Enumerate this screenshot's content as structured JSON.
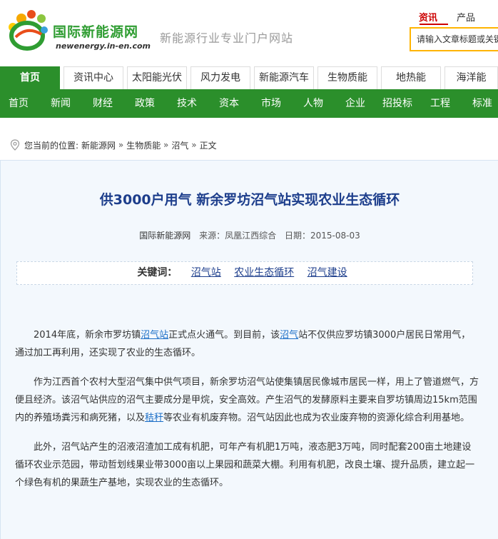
{
  "site": {
    "name": "国际新能源网",
    "domain": "newenergy.in-en.com",
    "slogan": "新能源行业专业门户网站"
  },
  "top_tabs": [
    {
      "label": "资讯",
      "active": true
    },
    {
      "label": "产品",
      "active": false
    }
  ],
  "search": {
    "placeholder": "请输入文章标题或关键字"
  },
  "channels": [
    {
      "label": "首页",
      "active": true
    },
    {
      "label": "资讯中心",
      "active": false
    },
    {
      "label": "太阳能光伏",
      "active": false
    },
    {
      "label": "风力发电",
      "active": false
    },
    {
      "label": "新能源汽车",
      "active": false
    },
    {
      "label": "生物质能",
      "active": false
    },
    {
      "label": "地热能",
      "active": false
    },
    {
      "label": "海洋能",
      "active": false
    }
  ],
  "nav": [
    "首页",
    "新闻",
    "财经",
    "政策",
    "技术",
    "资本",
    "市场",
    "人物",
    "企业",
    "招投标",
    "工程",
    "标准"
  ],
  "breadcrumb": {
    "prefix": "您当前的位置:",
    "items": [
      "新能源网",
      "生物质能",
      "沼气",
      "正文"
    ]
  },
  "article": {
    "title": "供3000户用气 新余罗坊沼气站实现农业生态循环",
    "site": "国际新能源网",
    "source": "来源：凤凰江西综合",
    "date": "日期：2015-08-03",
    "keywords_label": "关键词：",
    "keywords": [
      "沼气站",
      "农业生态循环",
      "沼气建设"
    ],
    "p1": {
      "a": "2014年底，新余市罗坊镇",
      "k1": "沼气站",
      "b": "正式点火通气。到目前，该",
      "k2": "沼气",
      "c": "站不仅供应罗坊镇3000户居民日常用气，通过加工再利用，还实现了农业的生态循环。"
    },
    "p2": {
      "a": "作为江西首个农村大型沼气集中供气项目，新余罗坊沼气站使集镇居民像城市居民一样，用上了管道燃气，方便且经济。该沼气站供应的沼气主要成分是甲烷，安全高效。产生沼气的发酵原料主要来自罗坊镇周边15km范围内的养殖场粪污和病死猪，以及",
      "k1": "秸秆",
      "b": "等农业有机废弃物。沼气站因此也成为农业废弃物的资源化综合利用基地。"
    },
    "p3": "此外，沼气站产生的沼液沼渣加工成有机肥，可年产有机肥1万吨，液态肥3万吨，同时配套200亩土地建设循环农业示范园，带动哲划线果业带3000亩以上果园和蔬菜大棚。利用有机肥，改良土壤、提升品质，建立起一个绿色有机的果蔬生产基地，实现农业的生态循环。"
  },
  "colors": {
    "brand_green": "#2b8f2b",
    "title_blue": "#1d3e8c",
    "accent_red": "#cc0000",
    "search_border": "#ffb400"
  }
}
